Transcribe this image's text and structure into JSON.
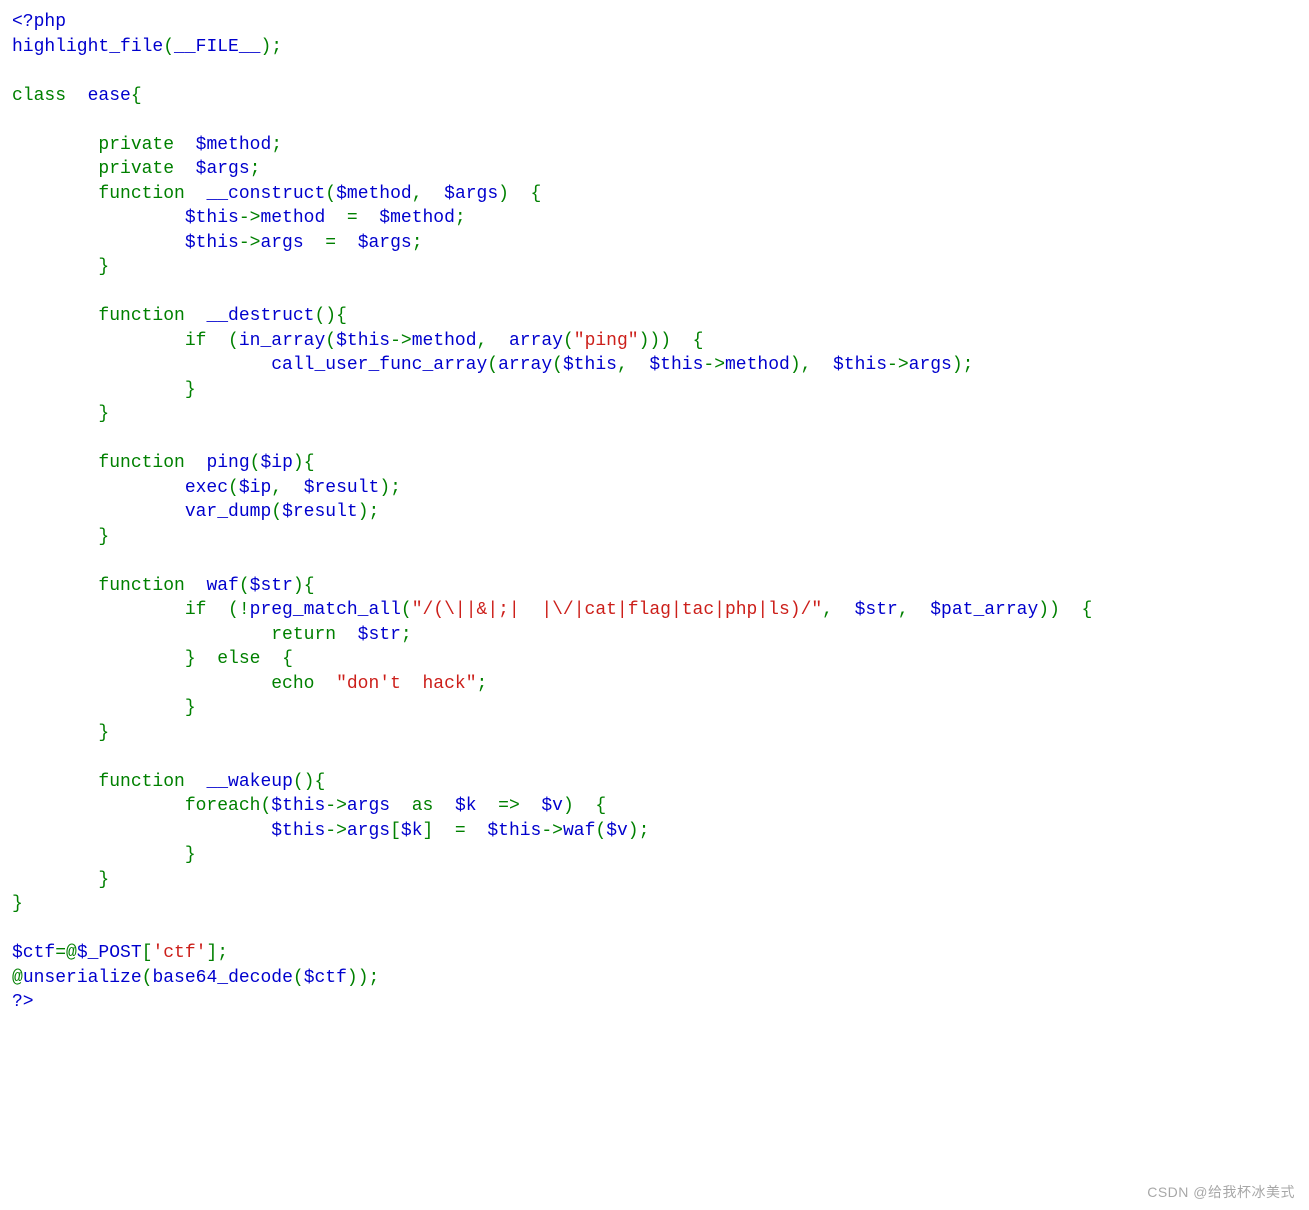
{
  "watermark": "CSDN @给我杯冰美式",
  "code": {
    "l01_open": "<?php",
    "l02_fn": "highlight_file",
    "l02_p1": "(",
    "l02_const": "__FILE__",
    "l02_p2": ");",
    "l04_kw_class": "class",
    "l04_name": "ease",
    "l04_brace": "{",
    "l06_kw": "private",
    "l06_var": "$method",
    "l06_semi": ";",
    "l07_kw": "private",
    "l07_var": "$args",
    "l07_semi": ";",
    "l08_kw": "function",
    "l08_name": "__construct",
    "l08_p1": "(",
    "l08_a1": "$method",
    "l08_comma": ",",
    "l08_a2": "$args",
    "l08_p2": ")  {",
    "l09_this": "$this",
    "l09_arrow": "->",
    "l09_prop": "method",
    "l09_eq": "=",
    "l09_rhs": "$method",
    "l09_semi": ";",
    "l10_this": "$this",
    "l10_arrow": "->",
    "l10_prop": "args",
    "l10_eq": "=",
    "l10_rhs": "$args",
    "l10_semi": ";",
    "l11_brace": "}",
    "l13_kw": "function",
    "l13_name": "__destruct",
    "l13_p": "(){",
    "l14_if": "if",
    "l14_p1": "(",
    "l14_fn": "in_array",
    "l14_p2": "(",
    "l14_this": "$this",
    "l14_arrow": "->",
    "l14_prop": "method",
    "l14_comma": ",",
    "l14_fn2": "array",
    "l14_p3": "(",
    "l14_str": "\"ping\"",
    "l14_p4": ")))  {",
    "l15_fn": "call_user_func_array",
    "l15_p1": "(",
    "l15_fn2": "array",
    "l15_p2": "(",
    "l15_this1": "$this",
    "l15_comma1": ",",
    "l15_this2": "$this",
    "l15_arrow2": "->",
    "l15_prop2": "method",
    "l15_p3": "),",
    "l15_this3": "$this",
    "l15_arrow3": "->",
    "l15_prop3": "args",
    "l15_p4": ");",
    "l16_brace": "}",
    "l17_brace": "}",
    "l19_kw": "function",
    "l19_name": "ping",
    "l19_p1": "(",
    "l19_arg": "$ip",
    "l19_p2": "){",
    "l20_fn": "exec",
    "l20_p1": "(",
    "l20_a1": "$ip",
    "l20_comma": ",",
    "l20_a2": "$result",
    "l20_p2": ");",
    "l21_fn": "var_dump",
    "l21_p1": "(",
    "l21_a1": "$result",
    "l21_p2": ");",
    "l22_brace": "}",
    "l24_kw": "function",
    "l24_name": "waf",
    "l24_p1": "(",
    "l24_arg": "$str",
    "l24_p2": "){",
    "l25_if": "if",
    "l25_p1": "(!",
    "l25_fn": "preg_match_all",
    "l25_p2": "(",
    "l25_str": "\"/(\\||&|;|  |\\/|cat|flag|tac|php|ls)/\"",
    "l25_comma1": ",",
    "l25_a2": "$str",
    "l25_comma2": ",",
    "l25_a3": "$pat_array",
    "l25_p3": "))  {",
    "l26_return": "return",
    "l26_var": "$str",
    "l26_semi": ";",
    "l27_brace": "}",
    "l27_else": "else",
    "l27_brace2": "{",
    "l28_echo": "echo",
    "l28_str": "\"don't  hack\"",
    "l28_semi": ";",
    "l29_brace": "}",
    "l30_brace": "}",
    "l32_kw": "function",
    "l32_name": "__wakeup",
    "l32_p": "(){",
    "l33_foreach": "foreach",
    "l33_p1": "(",
    "l33_this": "$this",
    "l33_arrow": "->",
    "l33_prop": "args",
    "l33_as": "as",
    "l33_k": "$k",
    "l33_arrow2": "=>",
    "l33_v": "$v",
    "l33_p2": ")  {",
    "l34_this": "$this",
    "l34_arrow": "->",
    "l34_prop": "args",
    "l34_b1": "[",
    "l34_k": "$k",
    "l34_b2": "]  =",
    "l34_this2": "$this",
    "l34_arrow2": "->",
    "l34_fn": "waf",
    "l34_p1": "(",
    "l34_v": "$v",
    "l34_p2": ");",
    "l35_brace": "}",
    "l36_brace": "}",
    "l37_brace": "}",
    "l39_var": "$ctf",
    "l39_eq": "=@",
    "l39_post": "$_POST",
    "l39_b1": "[",
    "l39_str": "'ctf'",
    "l39_b2": "];",
    "l40_at": "@",
    "l40_fn1": "unserialize",
    "l40_p1": "(",
    "l40_fn2": "base64_decode",
    "l40_p2": "(",
    "l40_var": "$ctf",
    "l40_p3": "));",
    "l41_close": "?>"
  }
}
